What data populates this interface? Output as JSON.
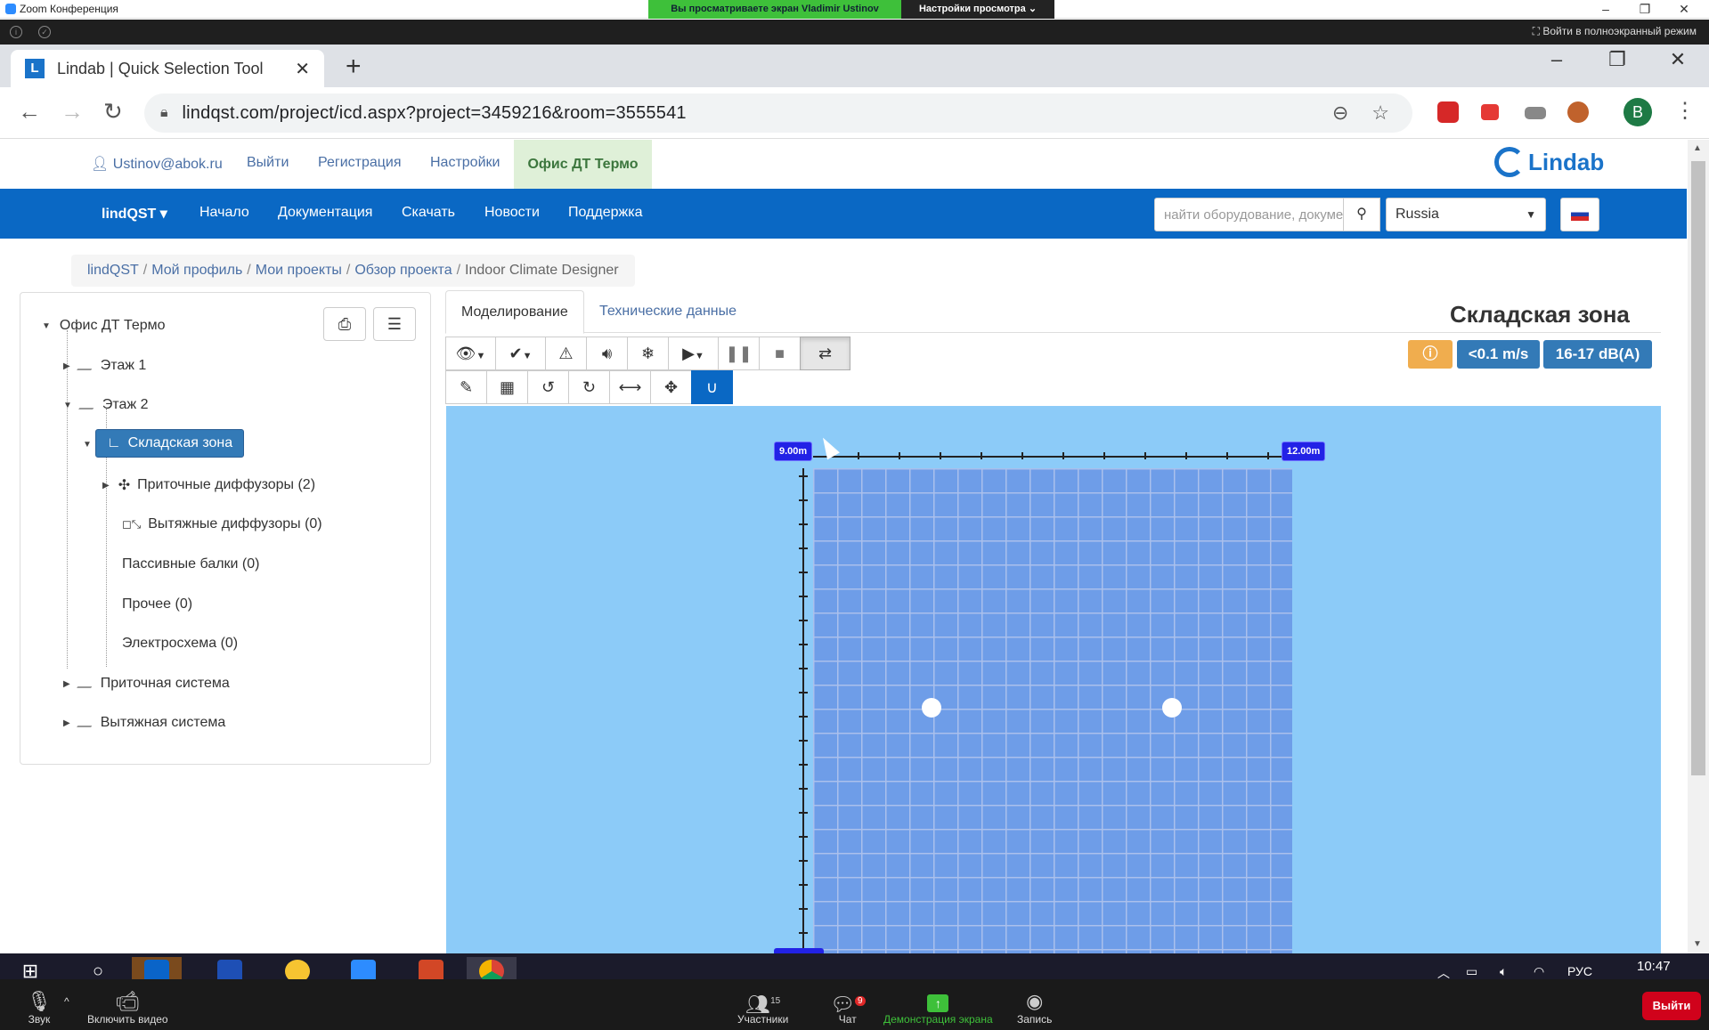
{
  "zoom": {
    "title": "Zoom Конференция",
    "sharing_banner": "Вы просматриваете экран Vladimir Ustinov",
    "view_settings": "Настройки просмотра",
    "fullscreen": "Войти в полноэкранный режим",
    "bottom": {
      "sound": "Звук",
      "video": "Включить видео",
      "participants": "Участники",
      "participants_count": "15",
      "chat": "Чат",
      "chat_count": "9",
      "share": "Демонстрация экрана",
      "record": "Запись",
      "leave": "Выйти"
    }
  },
  "browser": {
    "tab_title": "Lindab | Quick Selection Tool",
    "tab_favicon": "L",
    "url": "lindqst.com/project/icd.aspx?project=3459216&room=3555541",
    "profile_initial": "B"
  },
  "site": {
    "user_email": "Ustinov@abok.ru",
    "logout": "Выйти",
    "register": "Регистрация",
    "settings": "Настройки",
    "office": "Офис ДТ Термо",
    "logo": "Lindab",
    "nav": {
      "brand": "lindQST",
      "items": [
        "Начало",
        "Документация",
        "Скачать",
        "Новости",
        "Поддержка"
      ]
    },
    "search_placeholder": "найти оборудование, документы",
    "country": "Russia"
  },
  "breadcrumb": [
    "lindQST",
    "Мой профиль",
    "Мои проекты",
    "Обзор проекта",
    "Indoor Climate Designer"
  ],
  "tree": {
    "root": "Офис ДТ Термо",
    "floor1": "Этаж 1",
    "floor2": "Этаж 2",
    "zone": "Складская зона",
    "supply_diffusers": "Приточные диффузоры (2)",
    "exhaust_diffusers": "Вытяжные диффузоры (0)",
    "passive_beams": "Пассивные балки (0)",
    "other": "Прочее (0)",
    "electric": "Электросхема (0)",
    "supply_system": "Приточная система",
    "exhaust_system": "Вытяжная система"
  },
  "tabs": [
    "Моделирование",
    "Технические данные"
  ],
  "zone_title": "Складская зона",
  "badges": {
    "velocity": "<0.1 m/s",
    "noise": "16-17 dB(A)"
  },
  "canvas": {
    "label_left": "9.00m",
    "label_right": "12.00m"
  },
  "taskbar": {
    "lang": "РУС",
    "time": "10:47"
  },
  "colors": {
    "primary": "#0a68c4",
    "canvas_bg": "#8ccbf8",
    "grid": "#6e9de8",
    "badge_warn": "#f0ad4e",
    "badge_info": "#337ab7",
    "zoom_green": "#3ec03a"
  }
}
